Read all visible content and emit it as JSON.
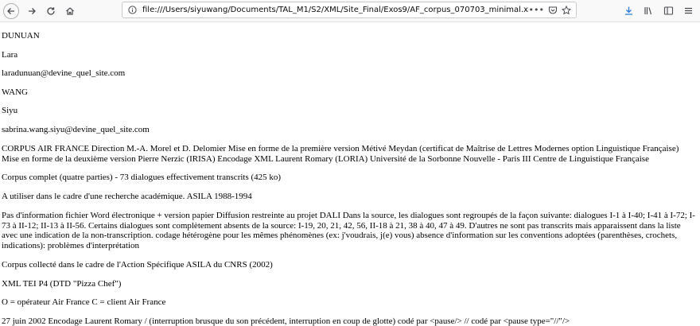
{
  "browser": {
    "url": "file:///Users/siyuwang/Documents/TAL_M1/S2/XML/Site_Final/Exos9/AF_corpus_070703_minimal.xml",
    "more_label": "•••"
  },
  "content": {
    "lines": [
      "DUNUAN",
      "Lara",
      "laradunuan@devine_quel_site.com",
      "WANG",
      "Siyu",
      "sabrina.wang.siyu@devine_quel_site.com",
      "CORPUS AIR FRANCE Direction M.-A. Morel et D. Delomier Mise en forme de la première version Métivé Meydan (certificat de Maîtrise de Lettres Modernes option Linguistique Française) Mise en forme de la deuxième version Pierre Nerzic (IRISA) Encodage XML Laurent Romary (LORIA) Université de la Sorbonne Nouvelle - Paris III Centre de Linguistique Française",
      "Corpus complet (quatre parties) - 73 dialogues effectivement transcrits (425 ko)",
      "A utiliser dans le cadre d'une recherche académique. ASILA 1988-1994",
      "Pas d'information fichier Word électronique + version papier Diffusion restreinte au projet DALI Dans la source, les dialogues sont regroupés de la façon suivante: dialogues I-1 à I-40; I-41 à I-72; I-73 à II-12; II-13 à II-56. Certains dialogues sont complètement absents de la source: I-19, 20, 21, 42, 56, II-18 à 21, 38 à 40, 47 à 49. D'autres ne sont pas transcrits mais apparaissent dans la liste avec une indication de la non-transcription. codage hétérogène pour les mêmes phénomènes (ex: j'voudrais, j(e) vous) absence d'information sur les conventions adoptées (parenthèses, crochets, indications): problèmes d'interprétation",
      "Corpus collecté dans le cadre de l'Action Spécifique ASILA du CNRS (2002)",
      "XML TEI P4 (DTD \"Pizza Chef\")",
      "O = opérateur Air France C = client Air France",
      "27 juin 2002 Encodage Laurent Romary / (interruption brusque du son précédent, interruption en coup de glotte) codé par <pause/> // codé par <pause type=\"//\"/>"
    ]
  }
}
